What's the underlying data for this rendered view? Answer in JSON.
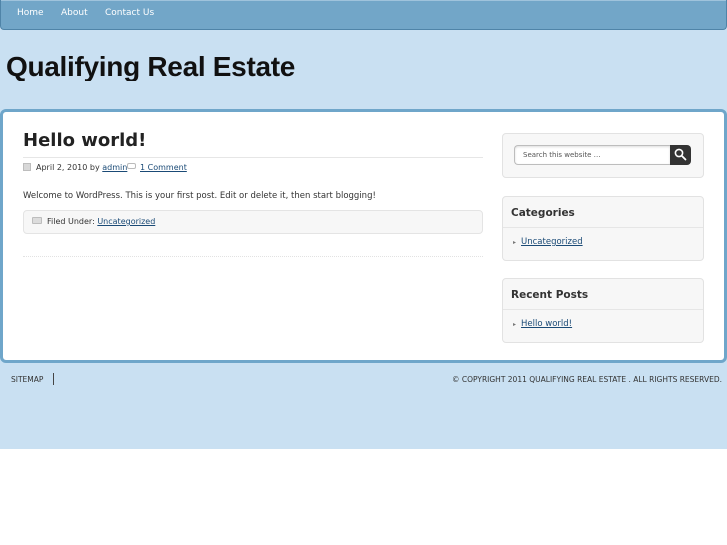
{
  "nav": {
    "items": [
      {
        "label": "Home"
      },
      {
        "label": "About"
      },
      {
        "label": "Contact Us"
      }
    ]
  },
  "site": {
    "title": "Qualifying Real Estate"
  },
  "post": {
    "title": "Hello world!",
    "date": "April 2, 2010",
    "by": "by",
    "author": "admin",
    "comments": "1 Comment",
    "body": "Welcome to WordPress. This is your first post. Edit or delete it, then start blogging!",
    "filed_label": "Filed Under:",
    "category": "Uncategorized"
  },
  "sidebar": {
    "search_placeholder": "Search this website …",
    "categories": {
      "title": "Categories",
      "items": [
        "Uncategorized"
      ]
    },
    "recent_posts": {
      "title": "Recent Posts",
      "items": [
        "Hello world!"
      ]
    }
  },
  "footer": {
    "sitemap": "SITEMAP",
    "copyright": "© COPYRIGHT 2011 QUALIFYING REAL ESTATE . ALL RIGHTS RESERVED."
  },
  "colors": {
    "nav_bg": "#72a6c8",
    "page_bg": "#c9e0f2",
    "wrap_border": "#6fa6ca",
    "link": "#1a4a76"
  }
}
